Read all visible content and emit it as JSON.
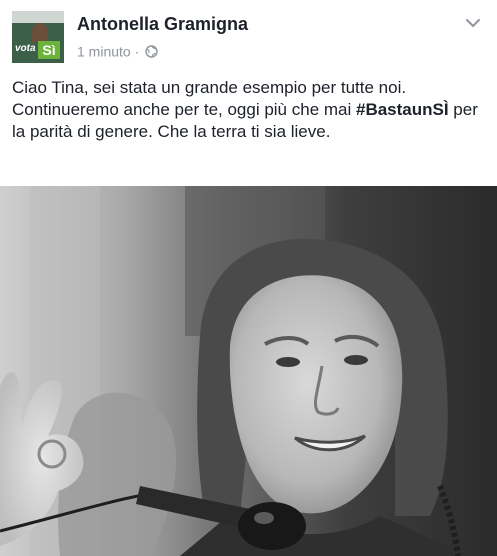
{
  "post": {
    "author": "Antonella Gramigna",
    "time": "1 minuto",
    "separator": "·",
    "text_before_hashtag": "Ciao Tina, sei stata un grande esempio per tutte noi. Continueremo anche per te, oggi più che mai ",
    "hashtag": "#BastaunSÌ",
    "text_after_hashtag": " per la parità di genere. Che la terra ti sia lieve.",
    "avatar": {
      "line1": "vota",
      "line2": "Sì"
    },
    "icons": {
      "privacy": "globe-icon",
      "menu": "chevron-down-icon"
    },
    "photo": {
      "style": "black-and-white",
      "subject": "woman-speaking-at-microphone"
    }
  }
}
